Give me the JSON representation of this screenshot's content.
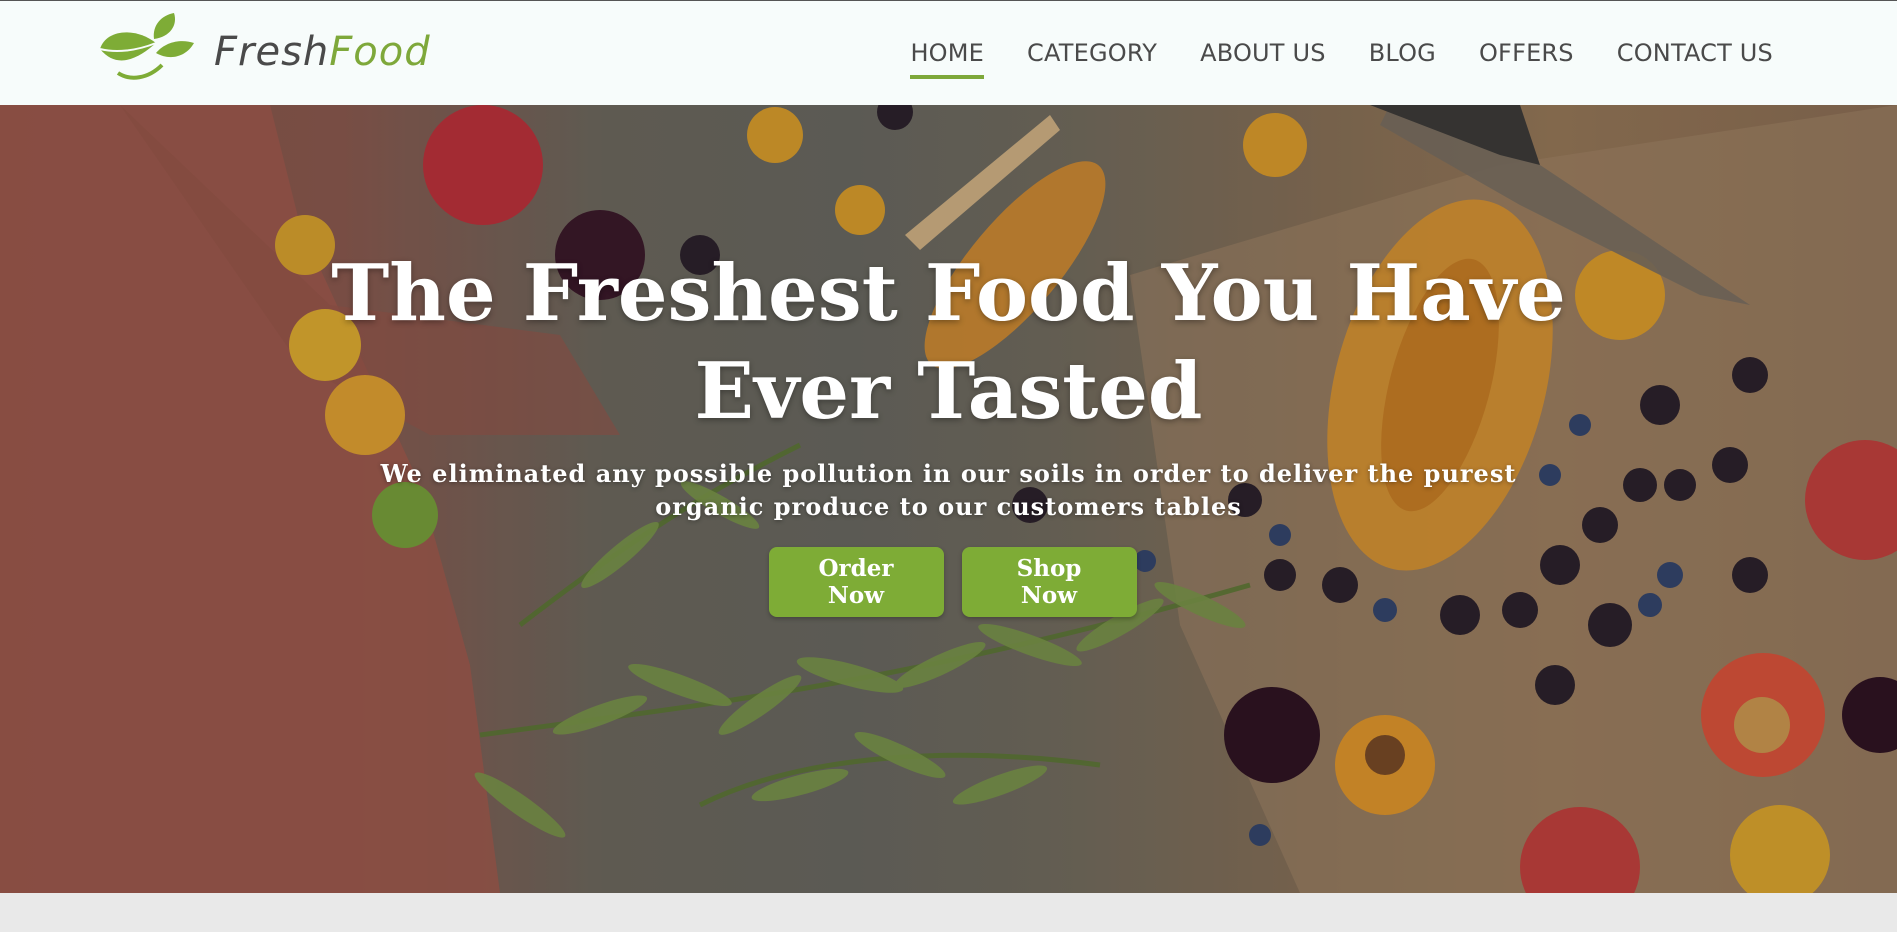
{
  "brand": {
    "name_part1": "Fresh",
    "name_part2": "Food",
    "accent_color": "#7eac36",
    "logo_icon": "leaf-icon"
  },
  "nav": {
    "items": [
      {
        "label": "HOME",
        "active": true
      },
      {
        "label": "CATEGORY",
        "active": false
      },
      {
        "label": "ABOUT US",
        "active": false
      },
      {
        "label": "BLOG",
        "active": false
      },
      {
        "label": "OFFERS",
        "active": false
      },
      {
        "label": "CONTACT US",
        "active": false
      }
    ]
  },
  "hero": {
    "title": "The Freshest Food You Have Ever Tasted",
    "subtitle": "We eliminated any possible pollution in our soils in order to deliver the purest organic produce to our customers tables",
    "buttons": {
      "order_label": "Order Now",
      "shop_label": "Shop Now"
    },
    "background": "fruits-on-table-photo"
  }
}
